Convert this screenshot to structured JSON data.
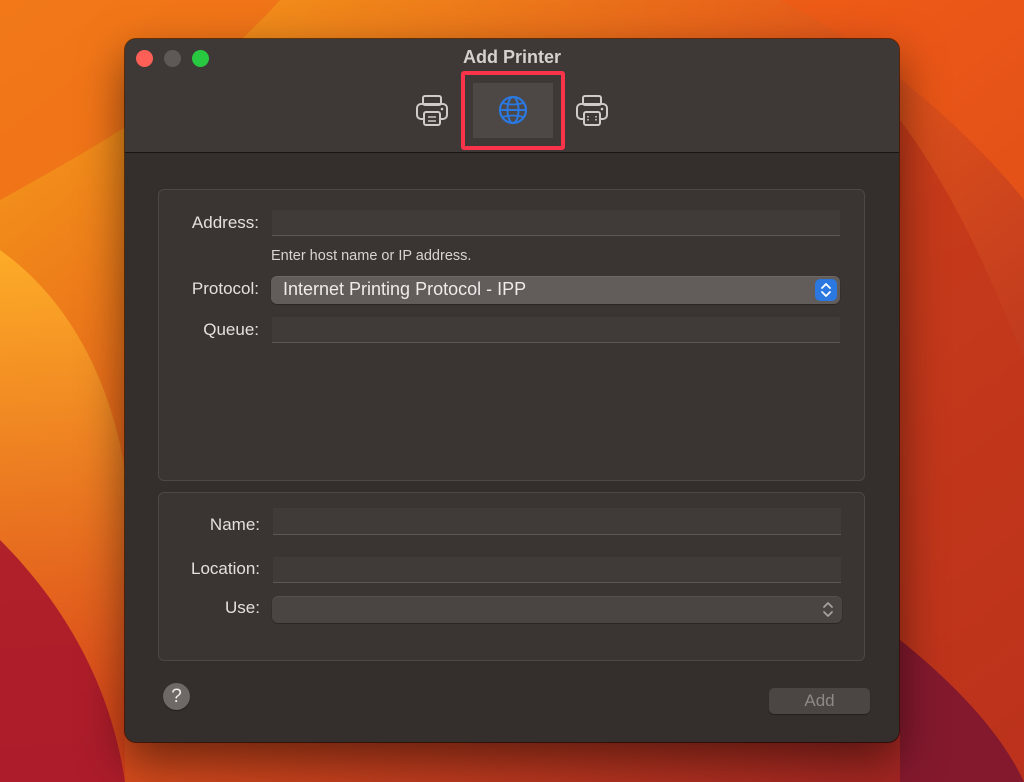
{
  "window": {
    "title": "Add Printer"
  },
  "toolbar": {
    "items": [
      {
        "icon": "printer-icon",
        "selected": false
      },
      {
        "icon": "globe-icon",
        "selected": true
      },
      {
        "icon": "windows-printer-icon",
        "selected": false
      }
    ]
  },
  "form": {
    "address_label": "Address:",
    "address_value": "",
    "address_hint": "Enter host name or IP address.",
    "protocol_label": "Protocol:",
    "protocol_value": "Internet Printing Protocol - IPP",
    "queue_label": "Queue:",
    "queue_value": "",
    "name_label": "Name:",
    "name_value": "",
    "location_label": "Location:",
    "location_value": "",
    "use_label": "Use:",
    "use_value": ""
  },
  "footer": {
    "help_label": "?",
    "add_label": "Add"
  },
  "colors": {
    "accent": "#2a78e0",
    "highlight": "#f8334a",
    "close": "#fe5f57",
    "zoom": "#28c840"
  }
}
